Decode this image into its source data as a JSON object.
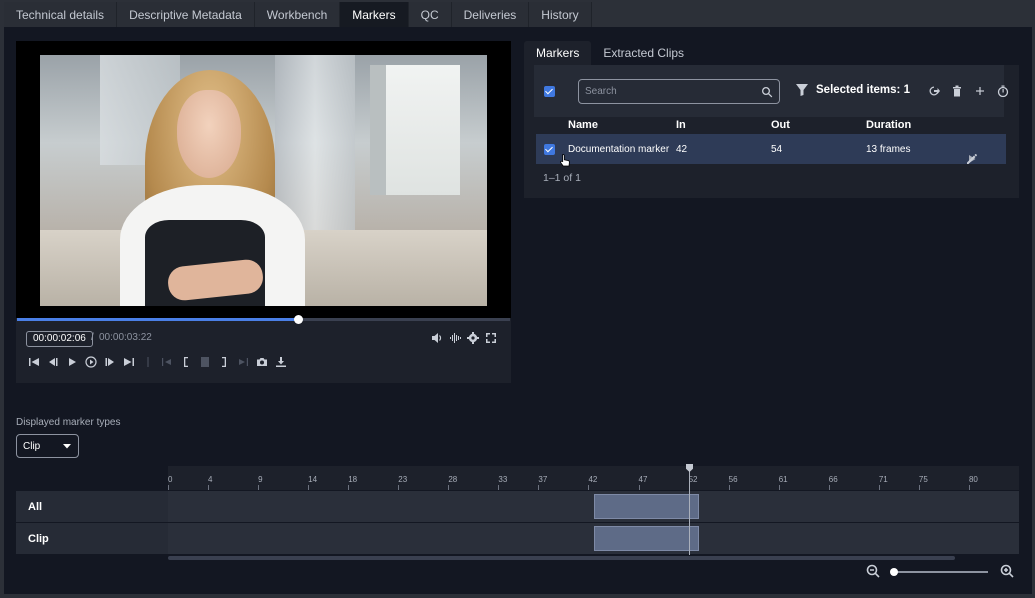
{
  "tabs": [
    "Technical details",
    "Descriptive Metadata",
    "Workbench",
    "Markers",
    "QC",
    "Deliveries",
    "History"
  ],
  "active_tab": "Markers",
  "player": {
    "current_time": "00:00:02:06",
    "separator": "/",
    "total_time": "00:00:03:22",
    "progress_fraction": 0.57
  },
  "markers_panel": {
    "tabs": [
      "Markers",
      "Extracted Clips"
    ],
    "search_placeholder": "Search",
    "selected_label": "Selected items: 1",
    "columns": [
      "Name",
      "In",
      "Out",
      "Duration"
    ],
    "rows": [
      {
        "name": "Documentation marker",
        "in": "42",
        "out": "54",
        "duration": "13 frames"
      }
    ],
    "pagination": "1–1 of 1"
  },
  "marker_types": {
    "label": "Displayed marker types",
    "value": "Clip"
  },
  "timeline": {
    "ticks": [
      "0",
      "4",
      "9",
      "14",
      "18",
      "23",
      "28",
      "33",
      "37",
      "42",
      "47",
      "52",
      "56",
      "61",
      "66",
      "71",
      "75",
      "80"
    ],
    "tracks": [
      {
        "label": "All",
        "segment": {
          "start": 42.5,
          "end": 53
        }
      },
      {
        "label": "Clip",
        "segment": {
          "start": 42.5,
          "end": 53
        }
      }
    ],
    "playhead": 52,
    "max": 85
  },
  "colors": {
    "accent": "#3f78e0",
    "selected_row": "#2e3b57",
    "segment": "#5e6b87"
  }
}
